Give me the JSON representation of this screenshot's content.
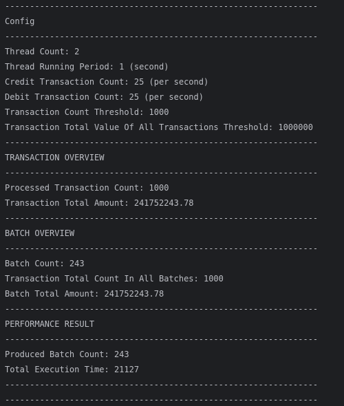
{
  "separator": "---------------------------------------------------------------",
  "config": {
    "title": "Config",
    "lines": [
      "Thread Count: 2",
      "Thread Running Period: 1 (second)",
      "Credit Transaction Count: 25 (per second)",
      "Debit Transaction Count: 25 (per second)",
      "Transaction Count Threshold: 1000",
      "Transaction Total Value Of All Transactions Threshold: 1000000"
    ]
  },
  "transaction_overview": {
    "title": "TRANSACTION OVERVIEW",
    "lines": [
      "Processed Transaction Count: 1000",
      "Transaction Total Amount: 241752243.78"
    ]
  },
  "batch_overview": {
    "title": "BATCH OVERVIEW",
    "lines": [
      "Batch Count: 243",
      "Transaction Total Count In All Batches: 1000",
      "Batch Total Amount: 241752243.78"
    ]
  },
  "performance_result": {
    "title": "PERFORMANCE RESULT",
    "lines": [
      "Produced Batch Count: 243",
      "Total Execution Time: 21127"
    ]
  }
}
